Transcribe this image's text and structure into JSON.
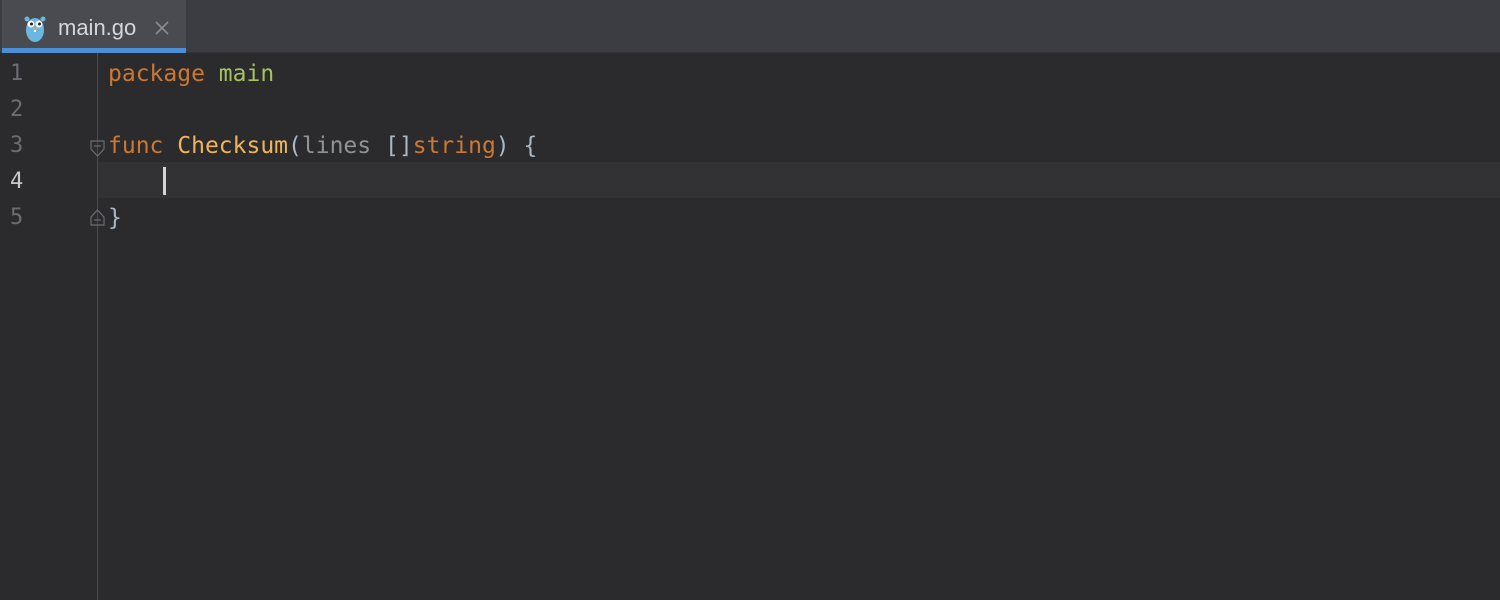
{
  "tab": {
    "title": "main.go",
    "icon": "gopher-icon",
    "close_icon": "close-icon"
  },
  "editor": {
    "line_numbers": [
      "1",
      "2",
      "3",
      "4",
      "5"
    ],
    "current_line": "4",
    "lines": {
      "l1": {
        "keyword": "package",
        "name": "main"
      },
      "l3": {
        "keyword": "func",
        "function": "Checksum",
        "open_paren": "(",
        "param": "lines",
        "brackets": "[]",
        "type": "string",
        "close": ") {"
      },
      "l5": {
        "brace": "}"
      }
    }
  },
  "colors": {
    "accent": "#4a8fd7",
    "keyword": "#cc7832",
    "function": "#f2b45a",
    "package_name": "#a5c261",
    "background": "#2b2b2d"
  }
}
